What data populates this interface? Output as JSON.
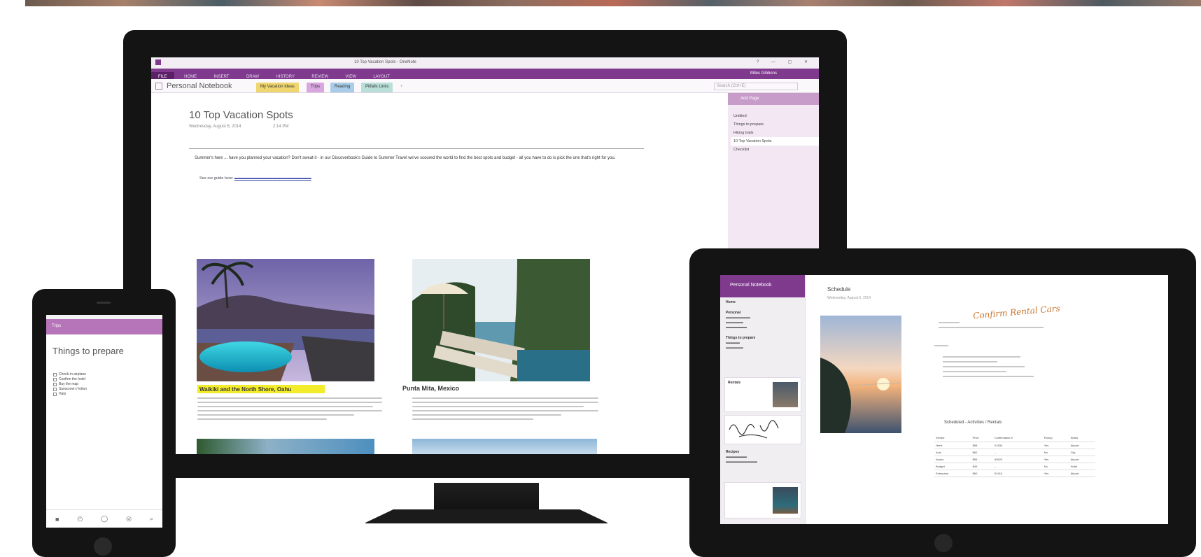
{
  "monitor": {
    "window_title": "10 Top Vacation Spots - OneNote",
    "ribbon_tabs": [
      "FILE",
      "HOME",
      "INSERT",
      "DRAW",
      "HISTORY",
      "REVIEW",
      "VIEW",
      "LAYOUT"
    ],
    "ribbon_user": "Miles Gibbons",
    "notebook_name": "Personal Notebook",
    "section_tabs": [
      "My Vacation Ideas",
      "Trips",
      "Reading",
      "Pitfalls Links"
    ],
    "search_placeholder": "Search (Ctrl+E)",
    "page_title": "10 Top Vacation Spots",
    "page_date": "Wednesday, August 6, 2014",
    "page_time": "2:14 PM",
    "intro_text": "Summer's here ... have you planned your vacation? Don't sweat it - in our Discoverbook's Guide to Summer Travel we've scoured the world to find the best spots and budget - all you have to do is pick the one that's right for you.",
    "intro_link_text": "See our guide here:",
    "caption_1": "Waikiki and the North Shore, Oahu",
    "caption_2": "Punta Mita, Mexico",
    "pages_header": "Add Page",
    "pages_list": [
      "Untitled",
      "Things to prepare",
      "Hiking trails",
      "10 Top Vacation Spots",
      "Checklist"
    ]
  },
  "phone": {
    "app_bar": "Trips",
    "title": "Things to prepare",
    "list_items": [
      "Check-in airplane",
      "Confirm the hotel",
      "Buy the map",
      "Sunscreen / lotion",
      "Hats"
    ]
  },
  "tablet": {
    "sidebar_header": "Personal Notebook",
    "sidebar_sections": [
      "Home",
      "Personal",
      "Things to prepare",
      "Rentals",
      "Recipes"
    ],
    "page_title": "Schedule",
    "page_date": "Wednesday, August 6, 2014",
    "handwritten": "Confirm Rental Cars",
    "table_heading": "Scheduled - Activities / Rentals",
    "table_rows": [
      [
        "Vendor",
        "Price",
        "Confirmation #",
        "Pickup",
        "Notes"
      ],
      [
        "Hertz",
        "$58",
        "X1534",
        "Yes",
        "Airport"
      ],
      [
        "Avis",
        "$62",
        "--",
        "No",
        "City"
      ],
      [
        "Alamo",
        "$55",
        "A9023",
        "Yes",
        "Airport"
      ],
      [
        "Budget",
        "$49",
        "--",
        "No",
        "Hotel"
      ],
      [
        "Enterprise",
        "$60",
        "E4410",
        "Yes",
        "Airport"
      ]
    ]
  },
  "colors": {
    "onenote_purple": "#7f3a8e",
    "section_tab_yellow": "#f0d66e",
    "highlight_yellow": "#f3ec2b"
  }
}
